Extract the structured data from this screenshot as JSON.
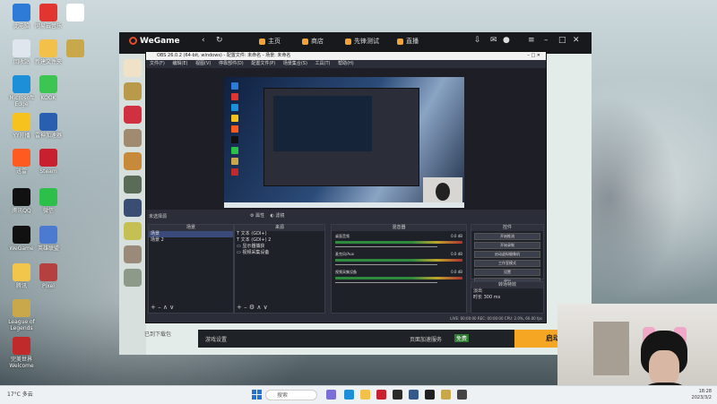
{
  "desktop": {
    "icons": [
      {
        "label": "此电脑",
        "color": "#2d7bd6"
      },
      {
        "label": "回收站",
        "color": "#dfe6ee"
      },
      {
        "label": "Microsoft Edge",
        "color": "#1c8fd8"
      },
      {
        "label": "YY开播",
        "color": "#f6c21d"
      },
      {
        "label": "迅雷",
        "color": "#ff5a1f"
      },
      {
        "label": "腾讯QQ",
        "color": "#111111"
      },
      {
        "label": "WeGame",
        "color": "#111111"
      },
      {
        "label": "腾讯",
        "color": "#f2c64a"
      },
      {
        "label": "League of Legends",
        "color": "#c8a84a"
      },
      {
        "label": "完美世界 Welcome",
        "color": "#c02a2a"
      },
      {
        "label": "网易云音乐",
        "color": "#e2352f"
      },
      {
        "label": "新建文件夹",
        "color": "#f3c04a"
      },
      {
        "label": "KOOK",
        "color": "#3cc553"
      },
      {
        "label": "雷神加速器",
        "color": "#2a5fb0"
      },
      {
        "label": "Steam",
        "color": "#c92030"
      },
      {
        "label": "微信",
        "color": "#2cc04a"
      },
      {
        "label": "英雄联盟",
        "color": "#4c7ad0"
      },
      {
        "label": "Pixel",
        "color": "#b64040"
      },
      {
        "label": "",
        "color": "#ffffff"
      },
      {
        "label": "",
        "color": "#c8a84a"
      }
    ]
  },
  "wegame": {
    "logo": "WeGame",
    "nav": [
      {
        "label": "主页",
        "color": "#f2a43a"
      },
      {
        "label": "商店",
        "color": "#f2a43a"
      },
      {
        "label": "先锋测试",
        "color": "#f2a43a"
      },
      {
        "label": "直播",
        "color": "#f2a43a"
      }
    ],
    "bottom": {
      "download_label": "游戏设置",
      "mid_label": "页面加速服务",
      "badge": "免费",
      "launch": "启动"
    },
    "dl_more": "已到下载包"
  },
  "obs": {
    "title": "OBS 26.0.2 (64-bit, windows) - 配置文件: 未命名 - 场景: 未命名",
    "menu": [
      "文件(F)",
      "编辑(E)",
      "视图(V)",
      "停靠部件(D)",
      "配置文件(P)",
      "场景集合(S)",
      "工具(T)",
      "帮助(H)"
    ],
    "scenes_label": "未选择源",
    "toolbar": [
      "属性",
      "滤镜"
    ],
    "panels": {
      "scenes": {
        "title": "场景",
        "items": [
          "场景",
          "场景 2"
        ]
      },
      "sources": {
        "title": "来源",
        "items": [
          "文本 (GDI+)",
          "文本 (GDI+) 2",
          "显示器捕获",
          "视频采集设备"
        ]
      },
      "mixer": {
        "title": "混音器",
        "tracks": [
          {
            "name": "桌面音频",
            "value": "0.0 dB"
          },
          {
            "name": "麦克风/Aux",
            "value": "0.0 dB"
          },
          {
            "name": "视频采集设备",
            "value": "0.0 dB"
          }
        ]
      },
      "transitions": {
        "title": "转场特效",
        "type": "淡出",
        "duration_label": "时长",
        "duration": "300 ms"
      },
      "controls": {
        "title": "控件",
        "buttons": [
          "开始推流",
          "开始录制",
          "启动虚拟摄像机",
          "工作室模式",
          "设置",
          "退出"
        ]
      }
    },
    "status": "LIVE: 00:00:00   REC: 00:00:00   CPU: 2.0%, 60.00 fps"
  },
  "taskbar": {
    "weather": "17°C 多云",
    "search_placeholder": "搜索",
    "clock_time": "18:28",
    "clock_date": "2023/3/2"
  }
}
